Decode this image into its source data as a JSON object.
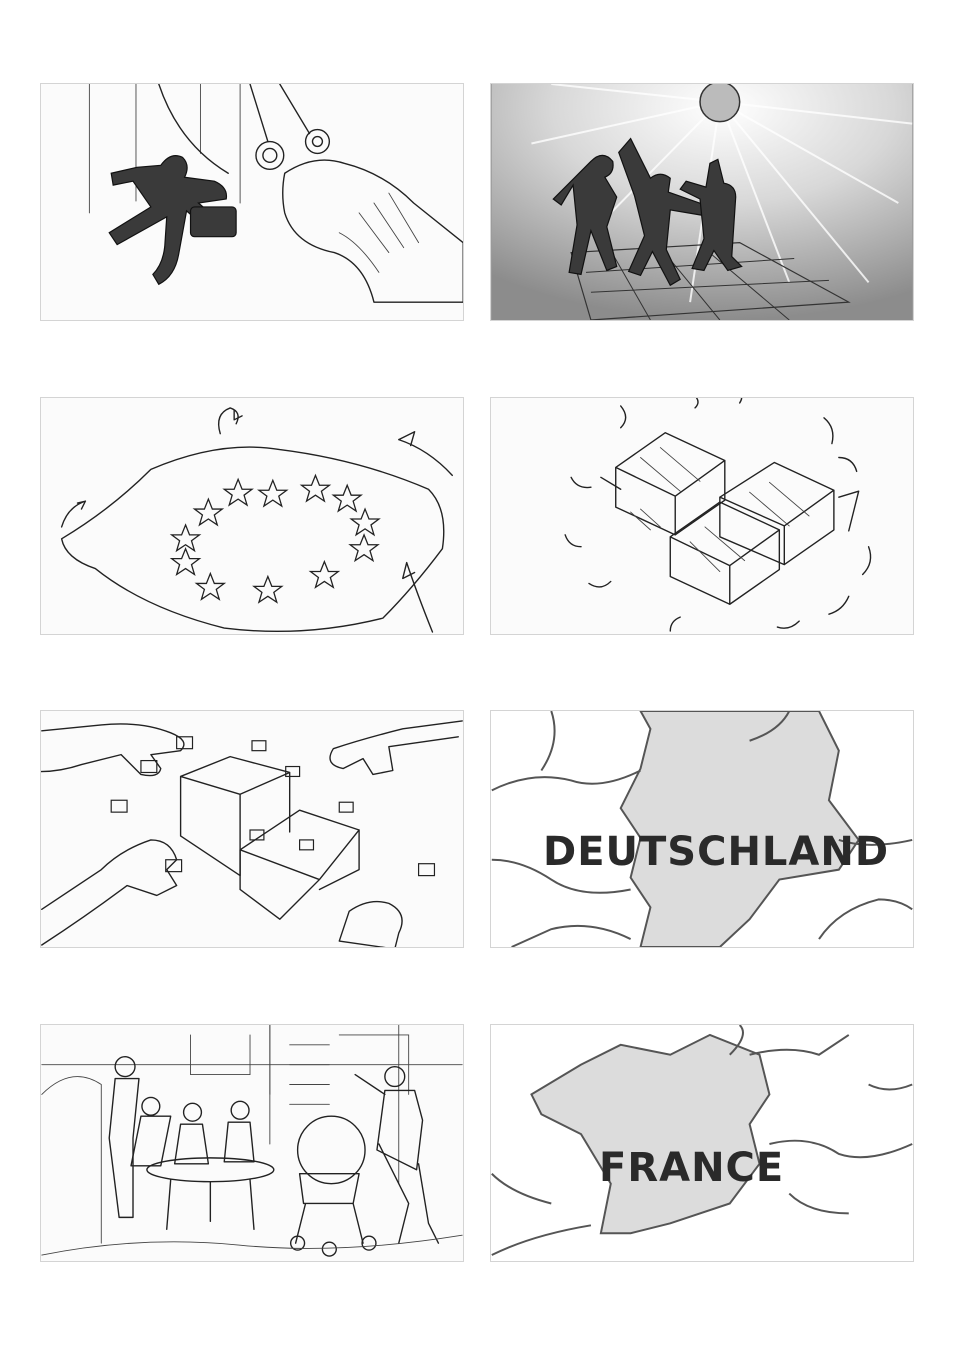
{
  "panels": [
    {
      "id": 1,
      "content": "marionette-figure-strings-cut-by-scissors"
    },
    {
      "id": 2,
      "content": "dancers-under-disco-ball"
    },
    {
      "id": 3,
      "content": "european-flag-being-folded"
    },
    {
      "id": 4,
      "content": "folded-paper-boxes"
    },
    {
      "id": 5,
      "content": "hands-placing-folders-in-boxes"
    },
    {
      "id": 6,
      "content": "map-germany",
      "label": "DEUTSCHLAND"
    },
    {
      "id": 7,
      "content": "family-at-cafe-table"
    },
    {
      "id": 8,
      "content": "map-france",
      "label": "FRANCE"
    }
  ],
  "colors": {
    "ink": "#222222",
    "map_fill": "#dcdcdc",
    "map_border": "#555555",
    "panel_bg": "#fbfbfb",
    "dark_panel_bg": "#9a9a9a"
  }
}
